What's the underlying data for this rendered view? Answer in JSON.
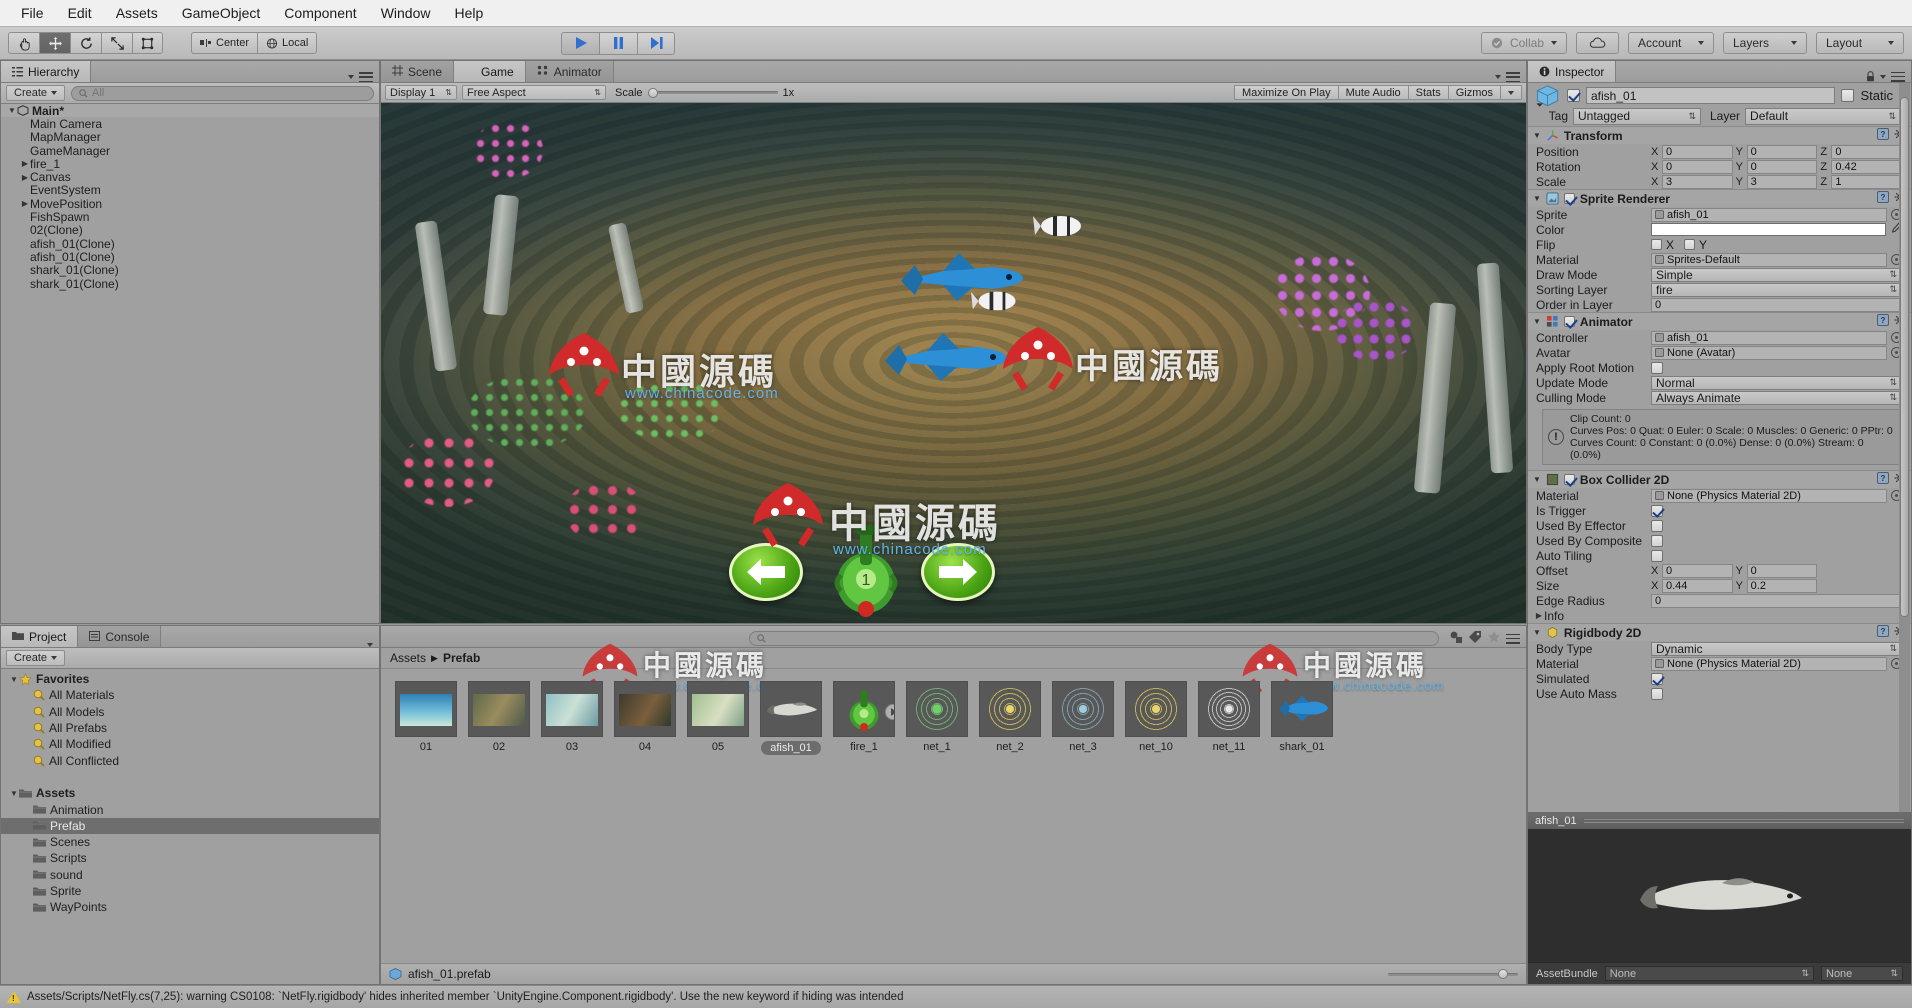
{
  "menubar": {
    "items": [
      "File",
      "Edit",
      "Assets",
      "GameObject",
      "Component",
      "Window",
      "Help"
    ]
  },
  "toolbar": {
    "tools": [
      "hand-tool",
      "move-tool",
      "rotate-tool",
      "scale-tool",
      "rect-tool"
    ],
    "pivot_label": "Center",
    "space_label": "Local",
    "play_label": "play",
    "pause_label": "pause",
    "step_label": "step",
    "collab_label": "Collab",
    "cloud_label": "cloud",
    "account_label": "Account",
    "layers_label": "Layers",
    "layout_label": "Layout"
  },
  "hierarchy": {
    "tab_label": "Hierarchy",
    "create_label": "Create",
    "search_placeholder": "All",
    "items": [
      {
        "label": "Main*",
        "depth": 0,
        "arrow": "down",
        "root": true
      },
      {
        "label": "Main Camera",
        "depth": 1,
        "arrow": "none"
      },
      {
        "label": "MapManager",
        "depth": 1,
        "arrow": "none"
      },
      {
        "label": "GameManager",
        "depth": 1,
        "arrow": "none"
      },
      {
        "label": "fire_1",
        "depth": 1,
        "arrow": "right"
      },
      {
        "label": "Canvas",
        "depth": 1,
        "arrow": "right"
      },
      {
        "label": "EventSystem",
        "depth": 1,
        "arrow": "none"
      },
      {
        "label": "MovePosition",
        "depth": 1,
        "arrow": "right"
      },
      {
        "label": "FishSpawn",
        "depth": 1,
        "arrow": "none"
      },
      {
        "label": "02(Clone)",
        "depth": 1,
        "arrow": "none"
      },
      {
        "label": "afish_01(Clone)",
        "depth": 1,
        "arrow": "none"
      },
      {
        "label": "afish_01(Clone)",
        "depth": 1,
        "arrow": "none"
      },
      {
        "label": "shark_01(Clone)",
        "depth": 1,
        "arrow": "none"
      },
      {
        "label": "shark_01(Clone)",
        "depth": 1,
        "arrow": "none"
      }
    ]
  },
  "gameview": {
    "tabs": [
      {
        "label": "Scene",
        "icon": "scene-grid-icon",
        "selected": false
      },
      {
        "label": "Game",
        "icon": "game-pad-icon",
        "selected": true
      },
      {
        "label": "Animator",
        "icon": "animator-icon",
        "selected": false
      }
    ],
    "display": "Display 1",
    "aspect": "Free Aspect",
    "scale_label": "Scale",
    "scale_value": "1x",
    "buttons": [
      "Maximize On Play",
      "Mute Audio",
      "Stats",
      "Gizmos"
    ],
    "watermarks": {
      "brand": "中國源碼",
      "url": "www.chinacode.com"
    }
  },
  "project": {
    "tabs": [
      {
        "label": "Project",
        "icon": "folder-icon",
        "selected": true
      },
      {
        "label": "Console",
        "icon": "console-icon",
        "selected": false
      }
    ],
    "create_label": "Create",
    "search_placeholder": "",
    "tree": [
      {
        "label": "Favorites",
        "depth": 0,
        "arrow": "down",
        "icon": "star",
        "bold": true
      },
      {
        "label": "All Materials",
        "depth": 1,
        "arrow": "none",
        "icon": "search"
      },
      {
        "label": "All Models",
        "depth": 1,
        "arrow": "none",
        "icon": "search"
      },
      {
        "label": "All Prefabs",
        "depth": 1,
        "arrow": "none",
        "icon": "search"
      },
      {
        "label": "All Modified",
        "depth": 1,
        "arrow": "none",
        "icon": "search"
      },
      {
        "label": "All Conflicted",
        "depth": 1,
        "arrow": "none",
        "icon": "search"
      },
      {
        "label": "",
        "depth": 0,
        "arrow": "none",
        "icon": "none",
        "spacer": true
      },
      {
        "label": "Assets",
        "depth": 0,
        "arrow": "down",
        "icon": "folder",
        "bold": true
      },
      {
        "label": "Animation",
        "depth": 1,
        "arrow": "none",
        "icon": "folder"
      },
      {
        "label": "Prefab",
        "depth": 1,
        "arrow": "none",
        "icon": "folder",
        "selected": true
      },
      {
        "label": "Scenes",
        "depth": 1,
        "arrow": "none",
        "icon": "folder"
      },
      {
        "label": "Scripts",
        "depth": 1,
        "arrow": "none",
        "icon": "folder"
      },
      {
        "label": "sound",
        "depth": 1,
        "arrow": "none",
        "icon": "folder"
      },
      {
        "label": "Sprite",
        "depth": 1,
        "arrow": "none",
        "icon": "folder"
      },
      {
        "label": "WayPoints",
        "depth": 1,
        "arrow": "none",
        "icon": "folder"
      }
    ],
    "breadcrumb": {
      "root": "Assets",
      "current": "Prefab"
    },
    "assets": [
      {
        "label": "01",
        "kind": "scene-blue"
      },
      {
        "label": "02",
        "kind": "scene-rock"
      },
      {
        "label": "03",
        "kind": "scene-teal"
      },
      {
        "label": "04",
        "kind": "scene-dark"
      },
      {
        "label": "05",
        "kind": "scene-green"
      },
      {
        "label": "afish_01",
        "kind": "fish-white",
        "selected": true
      },
      {
        "label": "fire_1",
        "kind": "cannon",
        "hasPlay": true
      },
      {
        "label": "net_1",
        "kind": "net-green"
      },
      {
        "label": "net_2",
        "kind": "net-yellow"
      },
      {
        "label": "net_3",
        "kind": "net-blue"
      },
      {
        "label": "net_10",
        "kind": "net-yellow"
      },
      {
        "label": "net_11",
        "kind": "net-white"
      },
      {
        "label": "shark_01",
        "kind": "fish-blue"
      }
    ],
    "selected_file": "afish_01.prefab"
  },
  "inspector": {
    "tab_label": "Inspector",
    "object_name": "afish_01",
    "enabled": true,
    "static_label": "Static",
    "tag_label": "Tag",
    "tag_value": "Untagged",
    "layer_label": "Layer",
    "layer_value": "Default",
    "components": [
      {
        "title": "Transform",
        "icon": "transform-icon",
        "has_checkbox": false,
        "rows": [
          {
            "label": "Position",
            "type": "vector3",
            "x": "0",
            "y": "0",
            "z": "0"
          },
          {
            "label": "Rotation",
            "type": "vector3",
            "x": "0",
            "y": "0",
            "z": "0.42"
          },
          {
            "label": "Scale",
            "type": "vector3",
            "x": "3",
            "y": "3",
            "z": "1"
          }
        ]
      },
      {
        "title": "Sprite Renderer",
        "icon": "sprite-renderer-icon",
        "has_checkbox": true,
        "checked": true,
        "rows": [
          {
            "label": "Sprite",
            "type": "object",
            "value": "afish_01"
          },
          {
            "label": "Color",
            "type": "color",
            "value": "#ffffff"
          },
          {
            "label": "Flip",
            "type": "flip",
            "x_label": "X",
            "y_label": "Y",
            "x": false,
            "y": false
          },
          {
            "label": "Material",
            "type": "object",
            "value": "Sprites-Default"
          },
          {
            "label": "Draw Mode",
            "type": "dropdown",
            "value": "Simple"
          },
          {
            "label": "Sorting Layer",
            "type": "dropdown",
            "value": "fire"
          },
          {
            "label": "Order in Layer",
            "type": "wide",
            "value": "0"
          }
        ]
      },
      {
        "title": "Animator",
        "icon": "animator-icon",
        "has_checkbox": true,
        "checked": true,
        "rows": [
          {
            "label": "Controller",
            "type": "object",
            "value": "afish_01"
          },
          {
            "label": "Avatar",
            "type": "object",
            "value": "None (Avatar)"
          },
          {
            "label": "Apply Root Motion",
            "type": "checkbox",
            "checked": false
          },
          {
            "label": "Update Mode",
            "type": "dropdown",
            "value": "Normal"
          },
          {
            "label": "Culling Mode",
            "type": "dropdown",
            "value": "Always Animate"
          }
        ],
        "info": "Clip Count: 0\nCurves Pos: 0 Quat: 0 Euler: 0 Scale: 0 Muscles: 0 Generic: 0 PPtr: 0\nCurves Count: 0 Constant: 0 (0.0%) Dense: 0 (0.0%) Stream: 0 (0.0%)"
      },
      {
        "title": "Box Collider 2D",
        "icon": "box-collider-icon",
        "has_checkbox": true,
        "checked": true,
        "rows": [
          {
            "label": "Material",
            "type": "object",
            "value": "None (Physics Material 2D)"
          },
          {
            "label": "Is Trigger",
            "type": "checkbox",
            "checked": true
          },
          {
            "label": "Used By Effector",
            "type": "checkbox",
            "checked": false
          },
          {
            "label": "Used By Composite",
            "type": "checkbox",
            "checked": false
          },
          {
            "label": "Auto Tiling",
            "type": "checkbox",
            "checked": false
          },
          {
            "label": "Offset",
            "type": "vector2",
            "x": "0",
            "y": "0"
          },
          {
            "label": "Size",
            "type": "vector2",
            "x": "0.44",
            "y": "0.2"
          },
          {
            "label": "Edge Radius",
            "type": "wide",
            "value": "0"
          },
          {
            "label": "Info",
            "type": "foldout"
          }
        ]
      },
      {
        "title": "Rigidbody 2D",
        "icon": "rigidbody-icon",
        "has_checkbox": false,
        "rows": [
          {
            "label": "Body Type",
            "type": "dropdown",
            "value": "Dynamic"
          },
          {
            "label": "Material",
            "type": "object",
            "value": "None (Physics Material 2D)"
          },
          {
            "label": "Simulated",
            "type": "checkbox",
            "checked": true
          },
          {
            "label": "Use Auto Mass",
            "type": "checkbox",
            "checked": false
          }
        ]
      }
    ],
    "preview_title": "afish_01",
    "assetbundle_label": "AssetBundle",
    "assetbundle_value": "None",
    "assetbundle_variant": "None"
  },
  "statusbar": {
    "message": "Assets/Scripts/NetFly.cs(7,25): warning CS0108: `NetFly.rigidbody' hides inherited member `UnityEngine.Component.rigidbody'. Use the new keyword if hiding was intended"
  }
}
